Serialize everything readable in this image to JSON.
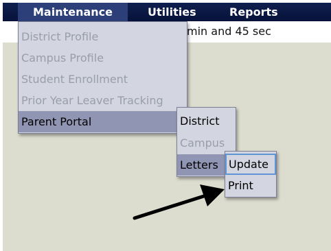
{
  "menubar": {
    "items": [
      {
        "label": "Maintenance"
      },
      {
        "label": "Utilities"
      },
      {
        "label": "Reports"
      }
    ]
  },
  "status": {
    "text": "min and 45 sec"
  },
  "maintenance_menu": {
    "items": [
      {
        "label": "District Profile",
        "state": "disabled"
      },
      {
        "label": "Campus Profile",
        "state": "disabled"
      },
      {
        "label": "Student Enrollment",
        "state": "disabled"
      },
      {
        "label": "Prior Year Leaver Tracking",
        "state": "disabled"
      },
      {
        "label": "Parent Portal",
        "state": "selected"
      }
    ]
  },
  "parent_portal_menu": {
    "items": [
      {
        "label": "District",
        "state": "enabled"
      },
      {
        "label": "Campus",
        "state": "disabled"
      },
      {
        "label": "Letters",
        "state": "selected"
      }
    ]
  },
  "letters_menu": {
    "items": [
      {
        "label": "Update",
        "state": "focused"
      },
      {
        "label": "Print",
        "state": "enabled"
      }
    ]
  },
  "annotation": {
    "icon": "arrow-icon",
    "color": "#000000"
  }
}
